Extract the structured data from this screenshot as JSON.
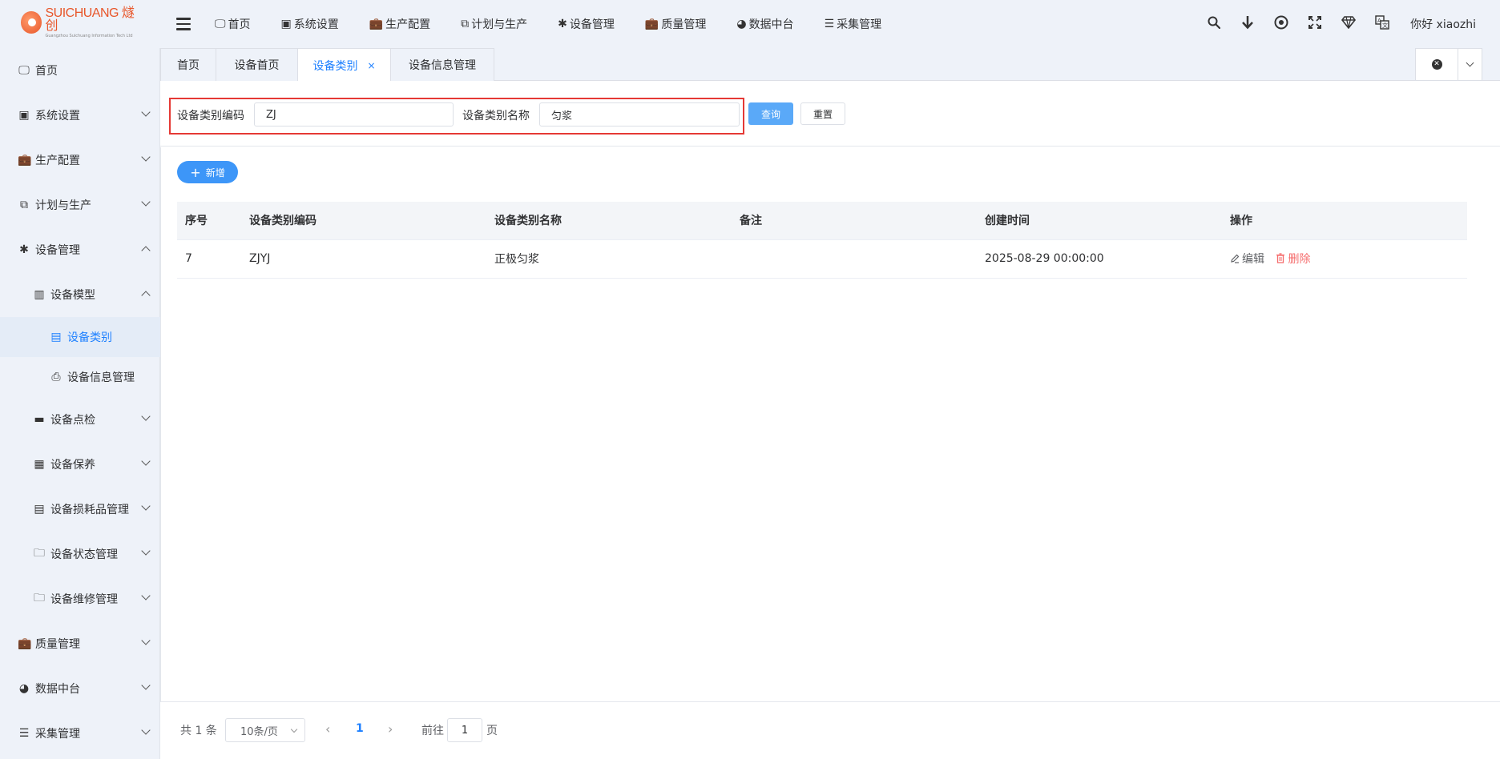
{
  "logo": {
    "main": "SUICHUANG 燧创",
    "sub": "Guangzhou Suichuang Information Tech Ltd"
  },
  "topnav": [
    {
      "icon": "🖵",
      "label": "首页"
    },
    {
      "icon": "▣",
      "label": "系统设置"
    },
    {
      "icon": "💼",
      "label": "生产配置"
    },
    {
      "icon": "⧉",
      "label": "计划与生产"
    },
    {
      "icon": "✱",
      "label": "设备管理"
    },
    {
      "icon": "💼",
      "label": "质量管理"
    },
    {
      "icon": "◕",
      "label": "数据中台"
    },
    {
      "icon": "☰",
      "label": "采集管理"
    }
  ],
  "header_right": {
    "greeting": "你好 xiaozhi"
  },
  "sidebar": {
    "items": [
      {
        "icon": "🖵",
        "label": "首页"
      },
      {
        "icon": "▣",
        "label": "系统设置"
      },
      {
        "icon": "💼",
        "label": "生产配置"
      },
      {
        "icon": "⧉",
        "label": "计划与生产"
      },
      {
        "icon": "✱",
        "label": "设备管理"
      },
      {
        "icon": "▥",
        "label": "设备模型"
      },
      {
        "icon": "▤",
        "label": "设备类别"
      },
      {
        "icon": "⎙",
        "label": "设备信息管理"
      },
      {
        "icon": "▬",
        "label": "设备点检"
      },
      {
        "icon": "▦",
        "label": "设备保养"
      },
      {
        "icon": "▤",
        "label": "设备损耗品管理"
      },
      {
        "icon": "🗀",
        "label": "设备状态管理"
      },
      {
        "icon": "🗀",
        "label": "设备维修管理"
      },
      {
        "icon": "💼",
        "label": "质量管理"
      },
      {
        "icon": "◕",
        "label": "数据中台"
      },
      {
        "icon": "☰",
        "label": "采集管理"
      }
    ]
  },
  "tabs": [
    {
      "label": "首页"
    },
    {
      "label": "设备首页"
    },
    {
      "label": "设备类别",
      "close": "×"
    },
    {
      "label": "设备信息管理"
    }
  ],
  "search": {
    "code_label": "设备类别编码",
    "code_value": "ZJ",
    "name_label": "设备类别名称",
    "name_value": "匀浆",
    "query_button": "查询",
    "reset_button": "重置"
  },
  "toolbar": {
    "add_button": "新增",
    "add_icon": "+"
  },
  "table": {
    "headers": [
      "序号",
      "设备类别编码",
      "设备类别名称",
      "备注",
      "创建时间",
      "操作"
    ],
    "rows": [
      {
        "index": "7",
        "code": "ZJYJ",
        "name": "正极匀浆",
        "remark": "",
        "created": "2025-08-29 00:00:00",
        "edit": "编辑",
        "delete": "删除"
      }
    ]
  },
  "pagination": {
    "total_text": "共 1 条",
    "page_size": "10条/页",
    "prev": "‹",
    "current_page": "1",
    "next": "›",
    "goto_label": "前往",
    "goto_value": "1",
    "page_suffix": "页"
  },
  "colors": {
    "accent": "#1e80ff",
    "danger": "#f56c6c",
    "highlight": "#e53935",
    "sidebar_bg": "#eef2f9"
  }
}
